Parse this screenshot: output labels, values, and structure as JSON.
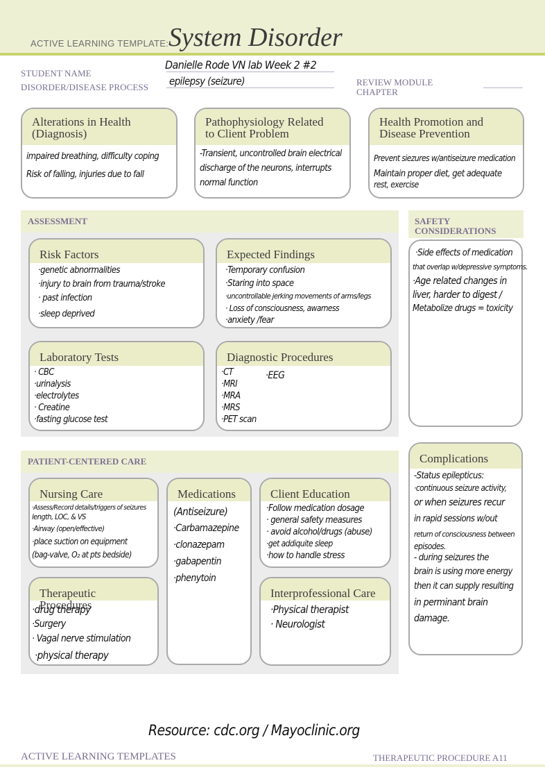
{
  "header": {
    "kicker": "ACTIVE LEARNING TEMPLATE:",
    "title": "System Disorder"
  },
  "student_info": {
    "student_name_label": "STUDENT NAME",
    "student_name_value": "Danielle Rode VN lab Week 2 #2",
    "disorder_label": "DISORDER/DISEASE PROCESS",
    "disorder_value": "epilepsy (seizure)",
    "review_module_label": "REVIEW MODULE",
    "chapter_label": "CHAPTER",
    "chapter_value": ""
  },
  "top_cards": {
    "alterations": {
      "title_line1": "Alterations in Health",
      "title_line2": "(Diagnosis)",
      "lines": [
        "impaired breathing, difficulty coping",
        "Risk of falling, injuries due to fall"
      ]
    },
    "pathophysiology": {
      "title_line1": "Pathophysiology Related",
      "title_line2": "to Client Problem",
      "lines": [
        "-Transient, uncontrolled brain electrical",
        "discharge of the neurons, interrupts",
        "normal function"
      ]
    },
    "health_promotion": {
      "title_line1": "Health Promotion and",
      "title_line2": "Disease Prevention",
      "lines": [
        "Prevent siezures w/antiseizure medication",
        "Maintain proper diet, get adequate",
        "rest, exercise"
      ]
    }
  },
  "assessment": {
    "section_title": "ASSESSMENT",
    "risk_factors": {
      "title": "Risk Factors",
      "lines": [
        "·genetic abnormalities",
        "·injury to brain from trauma/stroke",
        "· past infection",
        "·sleep deprived"
      ]
    },
    "expected_findings": {
      "title": "Expected Findings",
      "lines": [
        "·Temporary confusion",
        "·Staring into space",
        "·uncontrollable jerking movements of arms/legs",
        "· Loss of consciousness, awarness",
        "·anxiety /fear"
      ]
    },
    "laboratory_tests": {
      "title": "Laboratory Tests",
      "lines": [
        "· CBC",
        "·urinalysis",
        "·electrolytes",
        "· Creatine",
        "·fasting glucose test"
      ]
    },
    "diagnostic_procedures": {
      "title": "Diagnostic Procedures",
      "col1": [
        "·CT",
        "·MRI",
        "·MRA",
        "·MRS",
        "·PET scan"
      ],
      "col2": [
        "·EEG"
      ]
    }
  },
  "safety": {
    "title_line1": "SAFETY",
    "title_line2": "CONSIDERATIONS",
    "lines": [
      "·Side effects of medication",
      "that overlap w/depressive symptoms.",
      "",
      "·Age related changes in",
      "liver, harder to digest /",
      "Metabolize drugs = toxicity"
    ]
  },
  "patient_centered_care": {
    "section_title": "PATIENT-CENTERED CARE",
    "nursing_care": {
      "title": "Nursing Care",
      "lines": [
        "·Assess/Record details/triggers of seizures",
        "length, LOC, & VS",
        "·Airway (open/effective)",
        "·place suction on equipment",
        "(bag-valve, O₂ at pts bedside)"
      ]
    },
    "medications": {
      "title": "Medications",
      "lines": [
        "(Antiseizure)",
        "·Carbamazepine",
        "·clonazepam",
        "·gabapentin",
        "·phenytoin"
      ]
    },
    "client_education": {
      "title": "Client Education",
      "lines": [
        "·Follow medication dosage",
        "· general safety measures",
        "· avoid alcohol/drugs (abuse)",
        "·get addiquite sleep",
        "·how to handle stress"
      ]
    },
    "therapeutic_procedures": {
      "title": "Therapeutic Procedures",
      "lines": [
        "·drug therapy",
        "·Surgery",
        "· Vagal nerve stimulation",
        "·physical therapy"
      ]
    },
    "interprofessional_care": {
      "title": "Interprofessional Care",
      "lines": [
        "·Physical therapist",
        "· Neurologist"
      ]
    }
  },
  "complications": {
    "title": "Complications",
    "lines": [
      "-Status epilepticus:",
      " ·continuous seizure activity,",
      " or when seizures recur",
      " in rapid sessions w/out",
      "return of consciousness between",
      "episodes.",
      " - during seizures the",
      " brain is using more energy",
      " then it can supply resulting",
      " in perminant brain",
      " damage."
    ]
  },
  "footer": {
    "resource": "Resource: cdc.org / Mayoclinic.org",
    "left": "ACTIVE LEARNING TEMPLATES",
    "right": "THERAPEUTIC PROCEDURE   A11"
  }
}
